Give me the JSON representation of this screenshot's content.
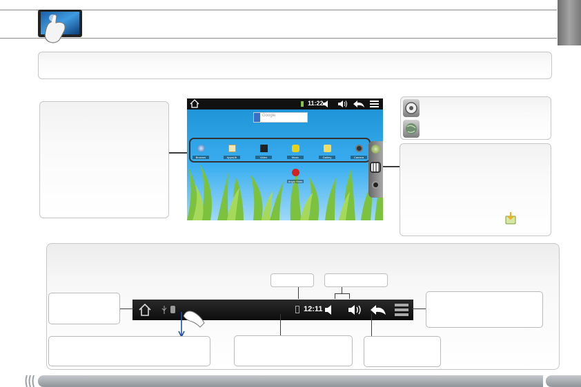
{
  "page": {
    "thumb_tab_color": "#8a8a8a",
    "footer_color": "#9aa0a5"
  },
  "tablet_screen": {
    "status_time": "11:22",
    "search_placeholder": "Google",
    "apps": [
      {
        "label": "Browser",
        "icon": "browser-icon"
      },
      {
        "label": "AppsLib",
        "icon": "appslib-icon"
      },
      {
        "label": "Video",
        "icon": "video-icon"
      },
      {
        "label": "Music",
        "icon": "music-icon"
      },
      {
        "label": "Gallery",
        "icon": "gallery-icon"
      },
      {
        "label": "Camera",
        "icon": "camera-icon"
      }
    ],
    "extra_app": {
      "label": "Angry Birds",
      "icon": "angry-birds-icon"
    }
  },
  "status_bar": {
    "time": "12:11",
    "icons": [
      "home-icon",
      "usb-icon",
      "notification-icon",
      "battery-icon",
      "volume-down-icon",
      "volume-up-icon",
      "back-icon",
      "menu-icon"
    ]
  }
}
